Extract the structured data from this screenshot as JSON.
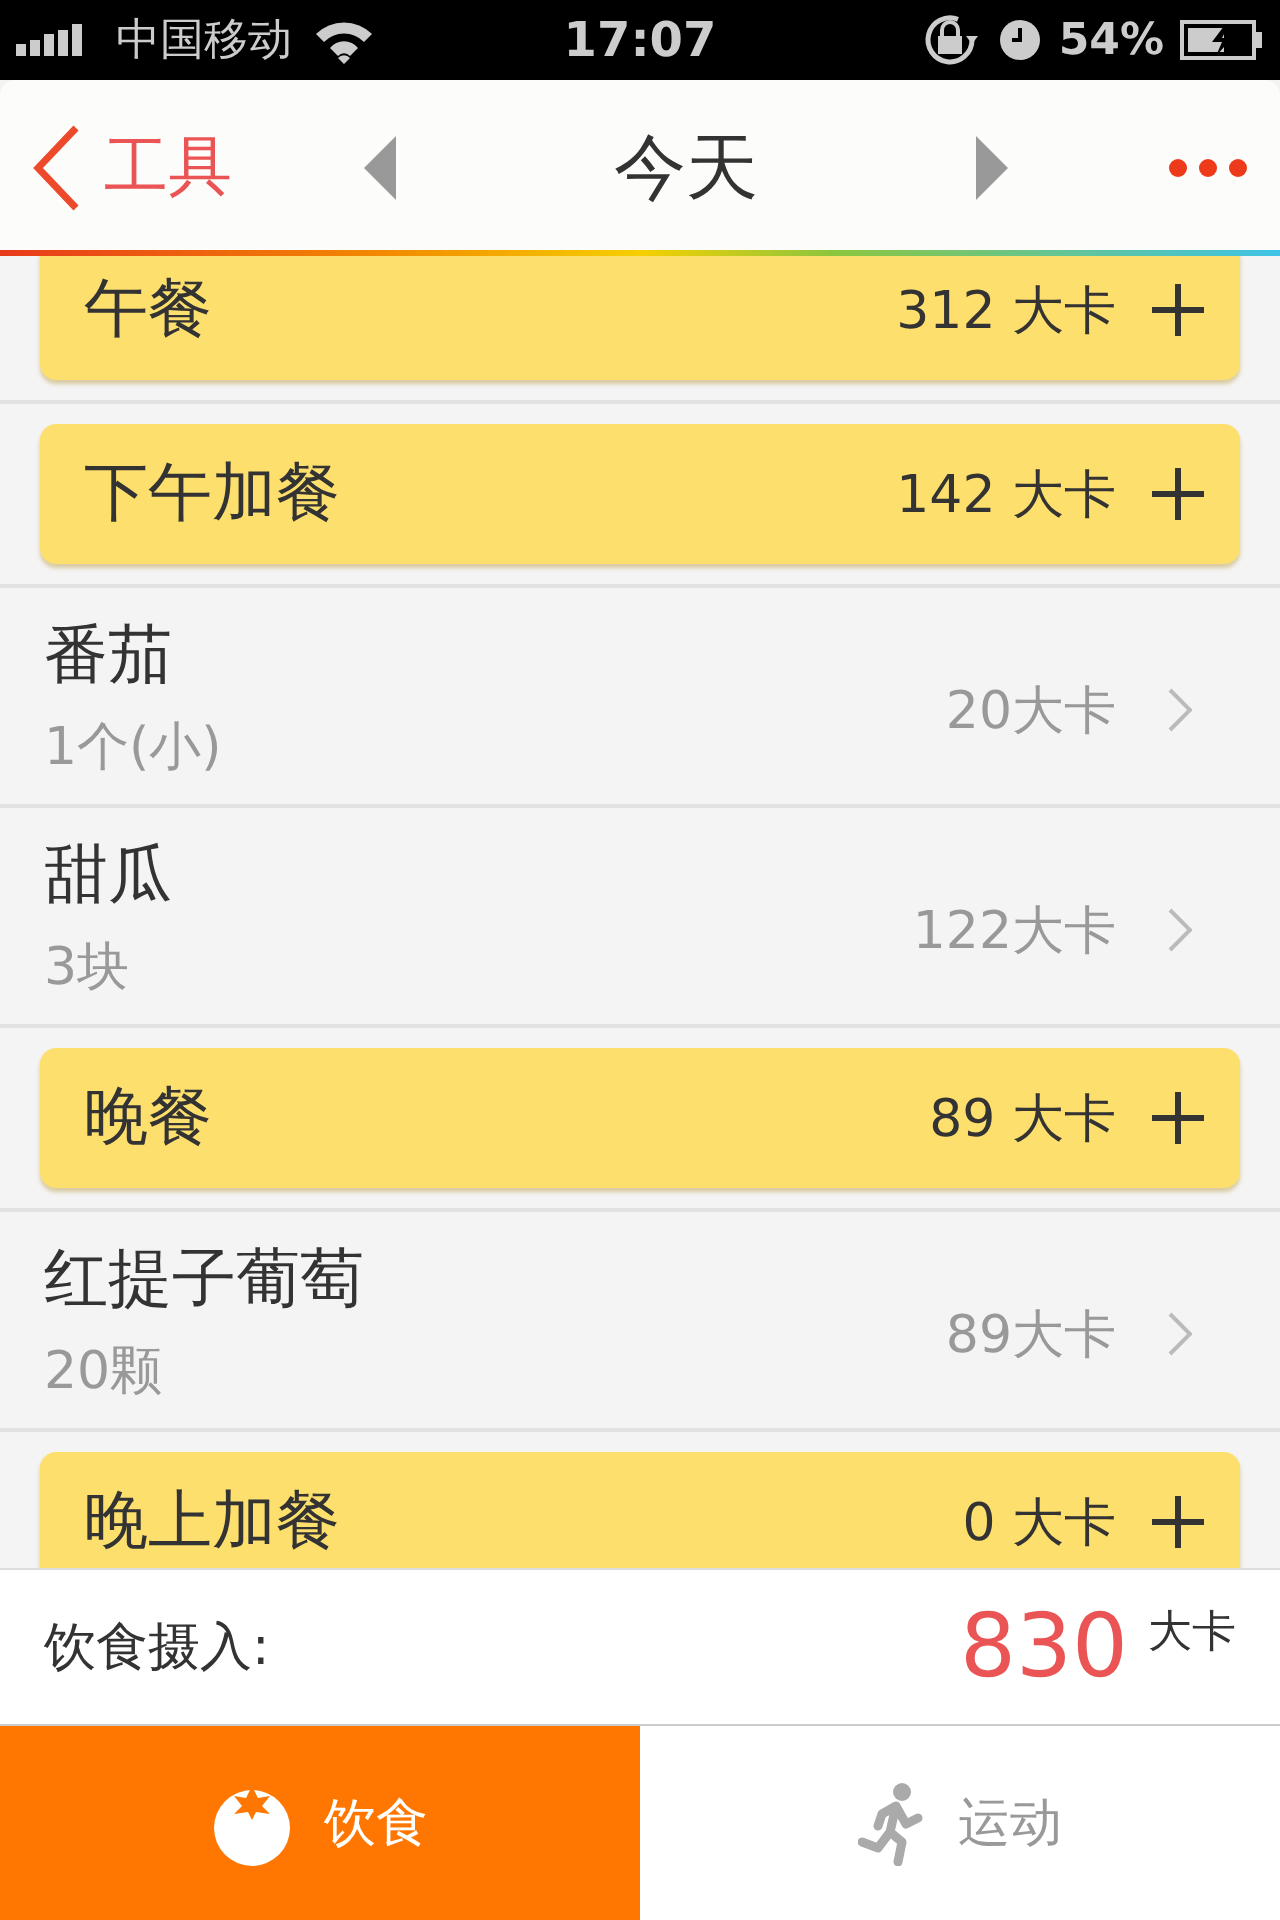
{
  "status_bar": {
    "carrier": "中国移动",
    "time": "17:07",
    "battery": "54%"
  },
  "nav": {
    "back": "工具",
    "title": "今天"
  },
  "meals": [
    {
      "name": "午餐",
      "calories": "312 大卡"
    },
    {
      "name": "下午加餐",
      "calories": "142 大卡",
      "items": [
        {
          "name": "番茄",
          "amount": "1个(小)",
          "calories": "20大卡"
        },
        {
          "name": "甜瓜",
          "amount": "3块",
          "calories": "122大卡"
        }
      ]
    },
    {
      "name": "晚餐",
      "calories": "89 大卡",
      "items": [
        {
          "name": "红提子葡萄",
          "amount": "20颗",
          "calories": "89大卡"
        }
      ]
    },
    {
      "name": "晚上加餐",
      "calories": "0 大卡"
    }
  ],
  "summary": {
    "label": "饮食摄入:",
    "value": "830",
    "unit": "大卡"
  },
  "tabs": [
    {
      "label": "饮食",
      "kind": "food",
      "selected": true
    },
    {
      "label": "运动",
      "kind": "exercise",
      "selected": false
    }
  ]
}
